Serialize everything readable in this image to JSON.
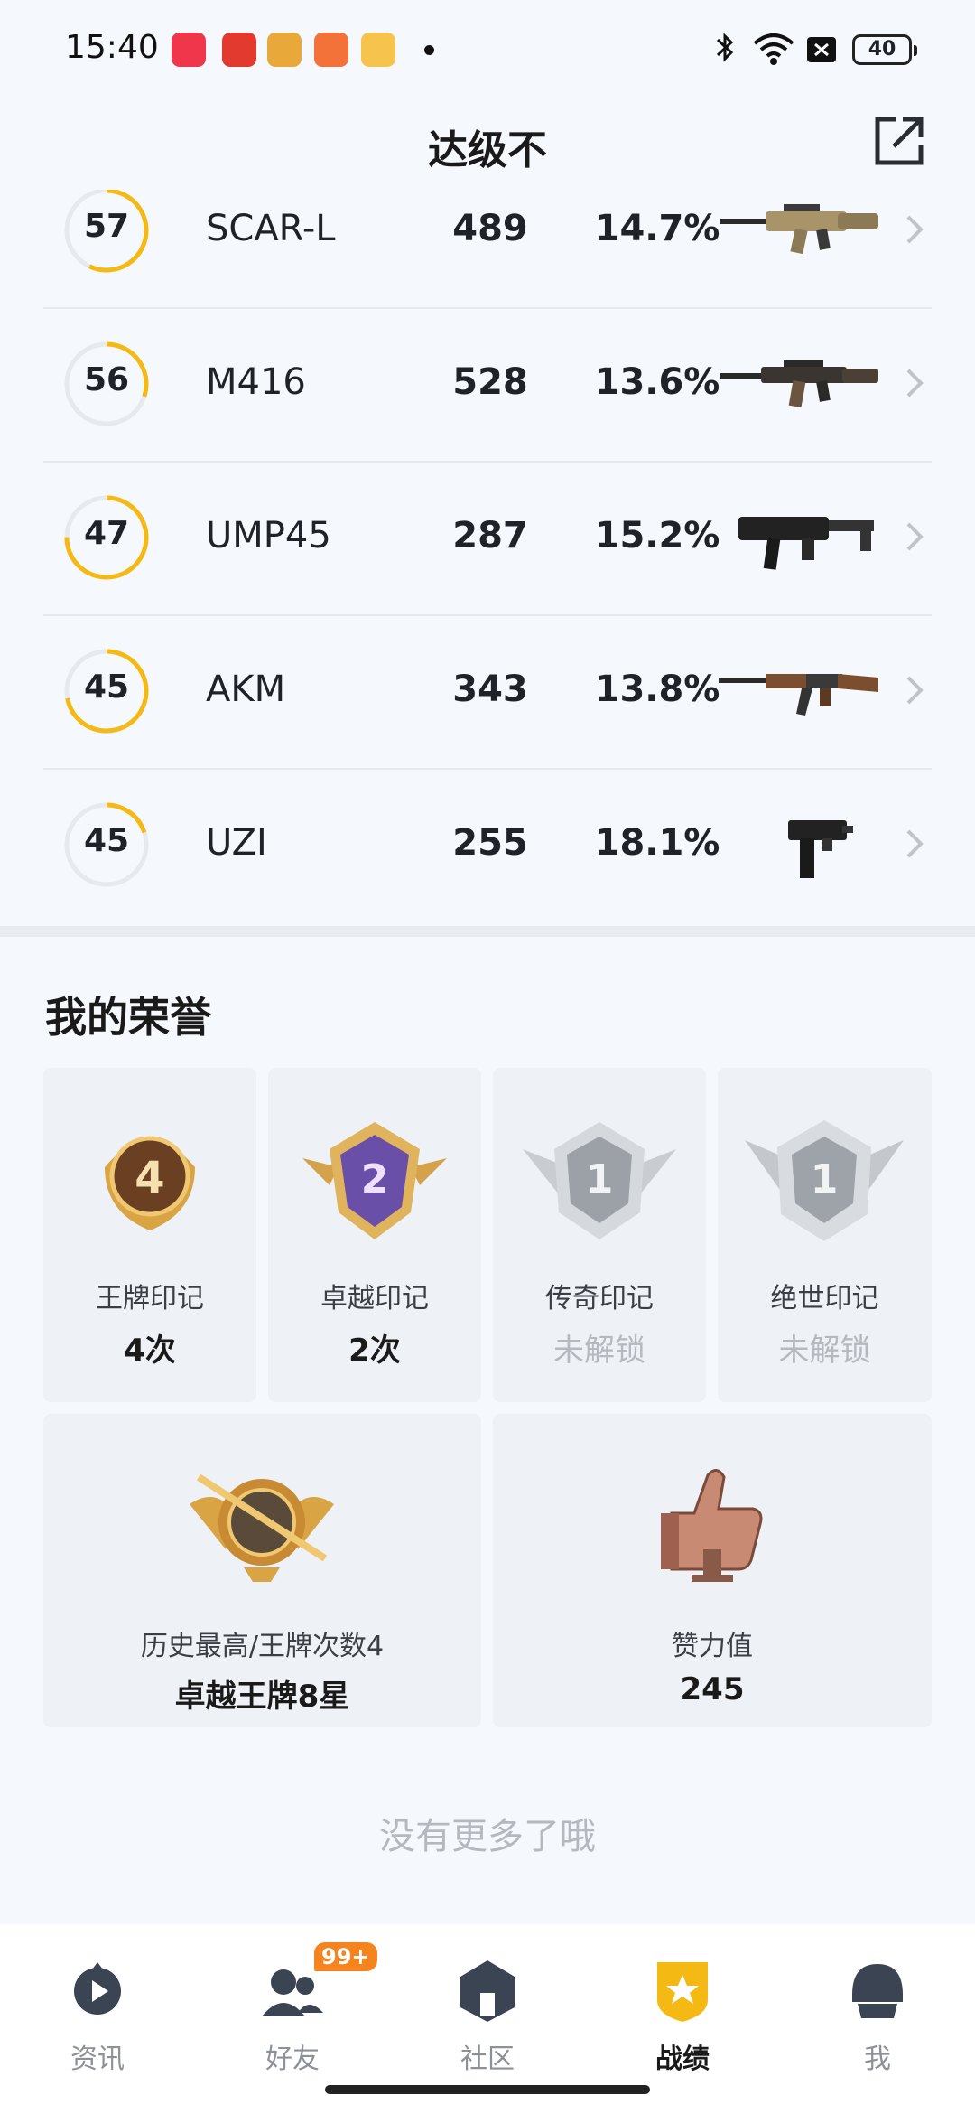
{
  "status_bar": {
    "time": "15:40",
    "battery": "40",
    "icons": [
      "bluetooth-icon",
      "wifi-icon",
      "sim-off-icon",
      "battery-icon"
    ]
  },
  "header": {
    "title": "达级不"
  },
  "weapons": [
    {
      "level": "57",
      "name": "SCAR-L",
      "kills": "489",
      "rate": "14.7%",
      "progress": 0.57
    },
    {
      "level": "56",
      "name": "M416",
      "kills": "528",
      "rate": "13.6%",
      "progress": 0.3
    },
    {
      "level": "47",
      "name": "UMP45",
      "kills": "287",
      "rate": "15.2%",
      "progress": 0.75
    },
    {
      "level": "45",
      "name": "AKM",
      "kills": "343",
      "rate": "13.8%",
      "progress": 0.72
    },
    {
      "level": "45",
      "name": "UZI",
      "kills": "255",
      "rate": "18.1%",
      "progress": 0.2
    }
  ],
  "honors": {
    "title": "我的荣誉",
    "marks": [
      {
        "label": "王牌印记",
        "value": "4次",
        "badge_number": "4",
        "locked": false
      },
      {
        "label": "卓越印记",
        "value": "2次",
        "badge_number": "2",
        "locked": false
      },
      {
        "label": "传奇印记",
        "value": "未解锁",
        "badge_number": "1",
        "locked": true
      },
      {
        "label": "绝世印记",
        "value": "未解锁",
        "badge_number": "1",
        "locked": true
      }
    ],
    "highest": {
      "label": "历史最高/王牌次数4",
      "value": "卓越王牌8星"
    },
    "likes": {
      "label": "赞力值",
      "value": "245"
    }
  },
  "footer_text": "没有更多了哦",
  "bottom_nav": {
    "items": [
      {
        "label": "资讯",
        "icon": "news-icon",
        "active": false
      },
      {
        "label": "好友",
        "icon": "friends-icon",
        "active": false,
        "badge": "99+"
      },
      {
        "label": "社区",
        "icon": "community-icon",
        "active": false
      },
      {
        "label": "战绩",
        "icon": "record-icon",
        "active": true
      },
      {
        "label": "我",
        "icon": "profile-icon",
        "active": false
      }
    ]
  },
  "colors": {
    "accent": "#f5b914",
    "ring_track": "#e6e9ee",
    "badge_orange": "#f5841f"
  }
}
